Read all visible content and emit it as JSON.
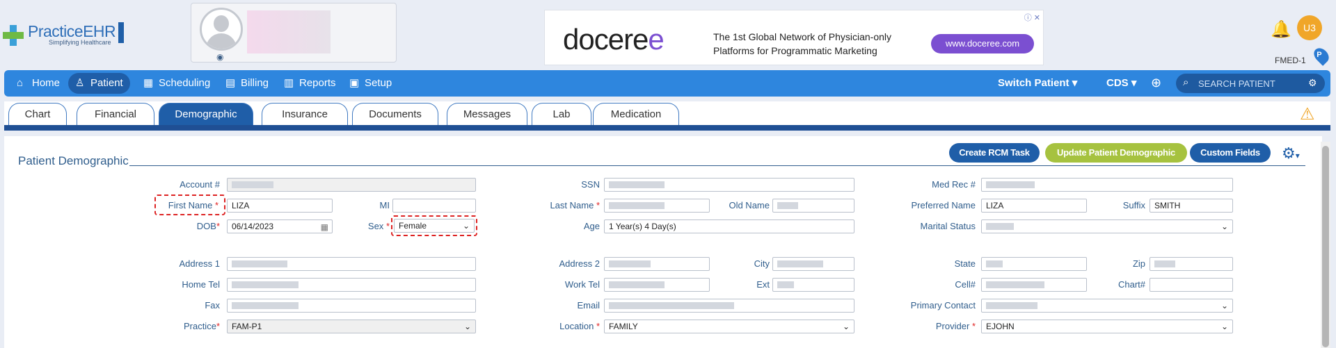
{
  "brand": {
    "logo_name": "PracticeEHR",
    "logo_tagline": "Simplifying Healthcare"
  },
  "ad": {
    "brand": "doceree",
    "line1": "The 1st Global Network of Physician-only",
    "line2": "Platforms for Programmatic Marketing",
    "button": "www.doceree.com",
    "info": "ⓘ ✕"
  },
  "user": {
    "initials": "U3",
    "facility": "FMED-1",
    "pin_label": "P"
  },
  "nav": {
    "items": [
      {
        "label": "Home",
        "icon": "home-icon",
        "glyph": "⌂"
      },
      {
        "label": "Patient",
        "icon": "person-icon",
        "glyph": "♙"
      },
      {
        "label": "Scheduling",
        "icon": "calendar-icon",
        "glyph": "▦"
      },
      {
        "label": "Billing",
        "icon": "invoice-icon",
        "glyph": "▤"
      },
      {
        "label": "Reports",
        "icon": "report-icon",
        "glyph": "▥"
      },
      {
        "label": "Setup",
        "icon": "monitor-icon",
        "glyph": "▣"
      }
    ],
    "active": "Patient",
    "switch_patient": "Switch Patient",
    "cds": "CDS",
    "search_placeholder": "SEARCH PATIENT"
  },
  "tabs": {
    "items": [
      "Chart",
      "Financial",
      "Demographic",
      "Insurance",
      "Documents",
      "Messages",
      "Lab",
      "Medication"
    ],
    "active": "Demographic"
  },
  "section": {
    "title": "Patient Demographic",
    "buttons": {
      "create_rcm": "Create RCM Task",
      "update_demographic": "Update Patient Demographic",
      "custom_fields": "Custom Fields"
    }
  },
  "form": {
    "labels": {
      "account": "Account #",
      "first_name": "First Name",
      "mi": "MI",
      "dob": "DOB",
      "sex": "Sex",
      "ssn": "SSN",
      "last_name": "Last Name",
      "age": "Age",
      "old_name": "Old Name",
      "med_rec": "Med Rec #",
      "preferred_name": "Preferred Name",
      "suffix": "Suffix",
      "marital_status": "Marital Status",
      "address1": "Address 1",
      "home_tel": "Home Tel",
      "fax": "Fax",
      "practice": "Practice",
      "address2": "Address 2",
      "city": "City",
      "work_tel": "Work Tel",
      "ext": "Ext",
      "email": "Email",
      "location": "Location",
      "state": "State",
      "zip": "Zip",
      "cell": "Cell#",
      "chart": "Chart#",
      "primary_contact": "Primary Contact",
      "provider": "Provider"
    },
    "values": {
      "first_name": "LIZA",
      "dob": "06/14/2023",
      "sex": "Female",
      "age": "1 Year(s) 4 Day(s)",
      "preferred_name": "LIZA",
      "suffix": "SMITH",
      "practice": "FAM-P1",
      "location": "FAMILY",
      "provider": "EJOHN"
    },
    "required_mark": "*"
  },
  "colors": {
    "nav_bar": "#2e86de",
    "active_nav": "#1f5ea8",
    "green_button": "#a6c23f",
    "required": "#e02020"
  }
}
